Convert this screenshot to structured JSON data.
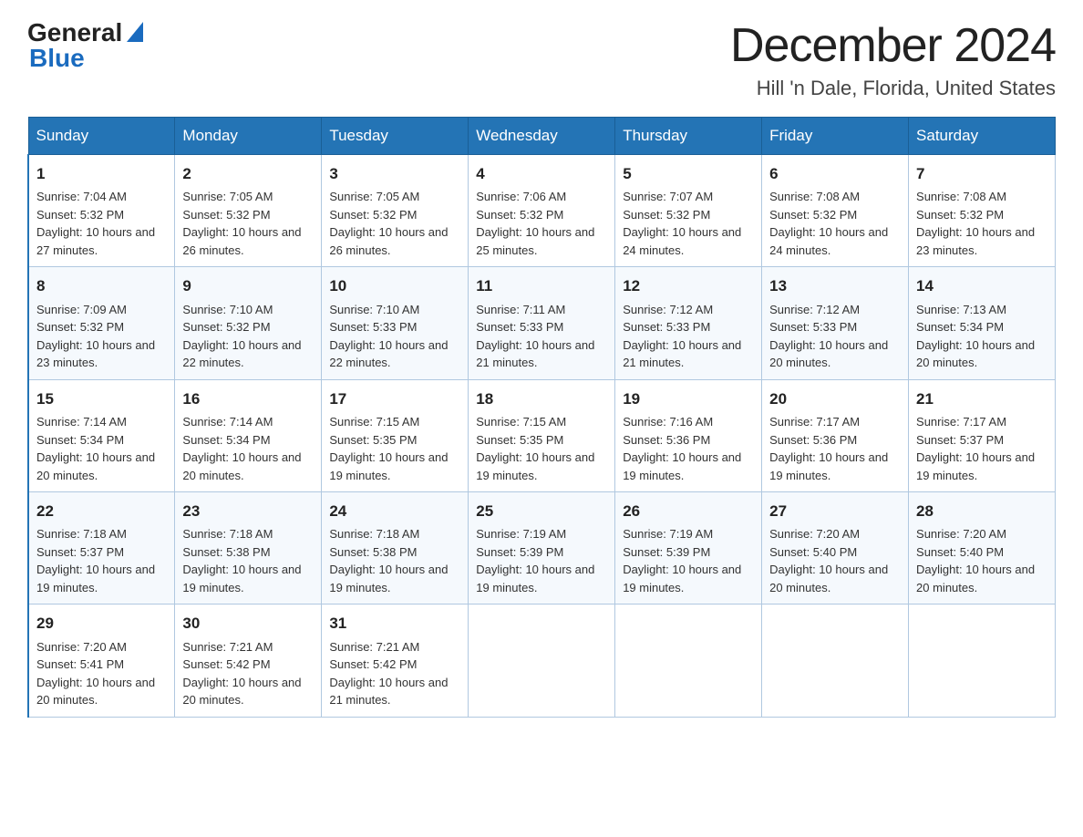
{
  "header": {
    "logo_general": "General",
    "logo_blue": "Blue",
    "month_title": "December 2024",
    "location": "Hill 'n Dale, Florida, United States"
  },
  "days_of_week": [
    "Sunday",
    "Monday",
    "Tuesday",
    "Wednesday",
    "Thursday",
    "Friday",
    "Saturday"
  ],
  "weeks": [
    [
      {
        "day": "1",
        "sunrise": "7:04 AM",
        "sunset": "5:32 PM",
        "daylight": "10 hours and 27 minutes."
      },
      {
        "day": "2",
        "sunrise": "7:05 AM",
        "sunset": "5:32 PM",
        "daylight": "10 hours and 26 minutes."
      },
      {
        "day": "3",
        "sunrise": "7:05 AM",
        "sunset": "5:32 PM",
        "daylight": "10 hours and 26 minutes."
      },
      {
        "day": "4",
        "sunrise": "7:06 AM",
        "sunset": "5:32 PM",
        "daylight": "10 hours and 25 minutes."
      },
      {
        "day": "5",
        "sunrise": "7:07 AM",
        "sunset": "5:32 PM",
        "daylight": "10 hours and 24 minutes."
      },
      {
        "day": "6",
        "sunrise": "7:08 AM",
        "sunset": "5:32 PM",
        "daylight": "10 hours and 24 minutes."
      },
      {
        "day": "7",
        "sunrise": "7:08 AM",
        "sunset": "5:32 PM",
        "daylight": "10 hours and 23 minutes."
      }
    ],
    [
      {
        "day": "8",
        "sunrise": "7:09 AM",
        "sunset": "5:32 PM",
        "daylight": "10 hours and 23 minutes."
      },
      {
        "day": "9",
        "sunrise": "7:10 AM",
        "sunset": "5:32 PM",
        "daylight": "10 hours and 22 minutes."
      },
      {
        "day": "10",
        "sunrise": "7:10 AM",
        "sunset": "5:33 PM",
        "daylight": "10 hours and 22 minutes."
      },
      {
        "day": "11",
        "sunrise": "7:11 AM",
        "sunset": "5:33 PM",
        "daylight": "10 hours and 21 minutes."
      },
      {
        "day": "12",
        "sunrise": "7:12 AM",
        "sunset": "5:33 PM",
        "daylight": "10 hours and 21 minutes."
      },
      {
        "day": "13",
        "sunrise": "7:12 AM",
        "sunset": "5:33 PM",
        "daylight": "10 hours and 20 minutes."
      },
      {
        "day": "14",
        "sunrise": "7:13 AM",
        "sunset": "5:34 PM",
        "daylight": "10 hours and 20 minutes."
      }
    ],
    [
      {
        "day": "15",
        "sunrise": "7:14 AM",
        "sunset": "5:34 PM",
        "daylight": "10 hours and 20 minutes."
      },
      {
        "day": "16",
        "sunrise": "7:14 AM",
        "sunset": "5:34 PM",
        "daylight": "10 hours and 20 minutes."
      },
      {
        "day": "17",
        "sunrise": "7:15 AM",
        "sunset": "5:35 PM",
        "daylight": "10 hours and 19 minutes."
      },
      {
        "day": "18",
        "sunrise": "7:15 AM",
        "sunset": "5:35 PM",
        "daylight": "10 hours and 19 minutes."
      },
      {
        "day": "19",
        "sunrise": "7:16 AM",
        "sunset": "5:36 PM",
        "daylight": "10 hours and 19 minutes."
      },
      {
        "day": "20",
        "sunrise": "7:17 AM",
        "sunset": "5:36 PM",
        "daylight": "10 hours and 19 minutes."
      },
      {
        "day": "21",
        "sunrise": "7:17 AM",
        "sunset": "5:37 PM",
        "daylight": "10 hours and 19 minutes."
      }
    ],
    [
      {
        "day": "22",
        "sunrise": "7:18 AM",
        "sunset": "5:37 PM",
        "daylight": "10 hours and 19 minutes."
      },
      {
        "day": "23",
        "sunrise": "7:18 AM",
        "sunset": "5:38 PM",
        "daylight": "10 hours and 19 minutes."
      },
      {
        "day": "24",
        "sunrise": "7:18 AM",
        "sunset": "5:38 PM",
        "daylight": "10 hours and 19 minutes."
      },
      {
        "day": "25",
        "sunrise": "7:19 AM",
        "sunset": "5:39 PM",
        "daylight": "10 hours and 19 minutes."
      },
      {
        "day": "26",
        "sunrise": "7:19 AM",
        "sunset": "5:39 PM",
        "daylight": "10 hours and 19 minutes."
      },
      {
        "day": "27",
        "sunrise": "7:20 AM",
        "sunset": "5:40 PM",
        "daylight": "10 hours and 20 minutes."
      },
      {
        "day": "28",
        "sunrise": "7:20 AM",
        "sunset": "5:40 PM",
        "daylight": "10 hours and 20 minutes."
      }
    ],
    [
      {
        "day": "29",
        "sunrise": "7:20 AM",
        "sunset": "5:41 PM",
        "daylight": "10 hours and 20 minutes."
      },
      {
        "day": "30",
        "sunrise": "7:21 AM",
        "sunset": "5:42 PM",
        "daylight": "10 hours and 20 minutes."
      },
      {
        "day": "31",
        "sunrise": "7:21 AM",
        "sunset": "5:42 PM",
        "daylight": "10 hours and 21 minutes."
      },
      null,
      null,
      null,
      null
    ]
  ],
  "labels": {
    "sunrise_prefix": "Sunrise: ",
    "sunset_prefix": "Sunset: ",
    "daylight_prefix": "Daylight: "
  }
}
